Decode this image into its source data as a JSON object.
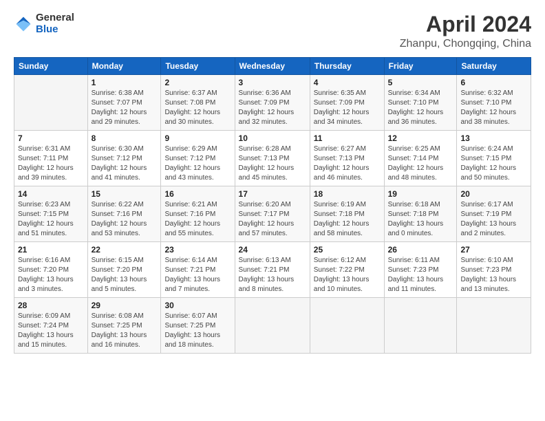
{
  "logo": {
    "general": "General",
    "blue": "Blue"
  },
  "title": "April 2024",
  "subtitle": "Zhanpu, Chongqing, China",
  "days_of_week": [
    "Sunday",
    "Monday",
    "Tuesday",
    "Wednesday",
    "Thursday",
    "Friday",
    "Saturday"
  ],
  "weeks": [
    [
      {
        "day": "",
        "info": ""
      },
      {
        "day": "1",
        "info": "Sunrise: 6:38 AM\nSunset: 7:07 PM\nDaylight: 12 hours\nand 29 minutes."
      },
      {
        "day": "2",
        "info": "Sunrise: 6:37 AM\nSunset: 7:08 PM\nDaylight: 12 hours\nand 30 minutes."
      },
      {
        "day": "3",
        "info": "Sunrise: 6:36 AM\nSunset: 7:09 PM\nDaylight: 12 hours\nand 32 minutes."
      },
      {
        "day": "4",
        "info": "Sunrise: 6:35 AM\nSunset: 7:09 PM\nDaylight: 12 hours\nand 34 minutes."
      },
      {
        "day": "5",
        "info": "Sunrise: 6:34 AM\nSunset: 7:10 PM\nDaylight: 12 hours\nand 36 minutes."
      },
      {
        "day": "6",
        "info": "Sunrise: 6:32 AM\nSunset: 7:10 PM\nDaylight: 12 hours\nand 38 minutes."
      }
    ],
    [
      {
        "day": "7",
        "info": "Sunrise: 6:31 AM\nSunset: 7:11 PM\nDaylight: 12 hours\nand 39 minutes."
      },
      {
        "day": "8",
        "info": "Sunrise: 6:30 AM\nSunset: 7:12 PM\nDaylight: 12 hours\nand 41 minutes."
      },
      {
        "day": "9",
        "info": "Sunrise: 6:29 AM\nSunset: 7:12 PM\nDaylight: 12 hours\nand 43 minutes."
      },
      {
        "day": "10",
        "info": "Sunrise: 6:28 AM\nSunset: 7:13 PM\nDaylight: 12 hours\nand 45 minutes."
      },
      {
        "day": "11",
        "info": "Sunrise: 6:27 AM\nSunset: 7:13 PM\nDaylight: 12 hours\nand 46 minutes."
      },
      {
        "day": "12",
        "info": "Sunrise: 6:25 AM\nSunset: 7:14 PM\nDaylight: 12 hours\nand 48 minutes."
      },
      {
        "day": "13",
        "info": "Sunrise: 6:24 AM\nSunset: 7:15 PM\nDaylight: 12 hours\nand 50 minutes."
      }
    ],
    [
      {
        "day": "14",
        "info": "Sunrise: 6:23 AM\nSunset: 7:15 PM\nDaylight: 12 hours\nand 51 minutes."
      },
      {
        "day": "15",
        "info": "Sunrise: 6:22 AM\nSunset: 7:16 PM\nDaylight: 12 hours\nand 53 minutes."
      },
      {
        "day": "16",
        "info": "Sunrise: 6:21 AM\nSunset: 7:16 PM\nDaylight: 12 hours\nand 55 minutes."
      },
      {
        "day": "17",
        "info": "Sunrise: 6:20 AM\nSunset: 7:17 PM\nDaylight: 12 hours\nand 57 minutes."
      },
      {
        "day": "18",
        "info": "Sunrise: 6:19 AM\nSunset: 7:18 PM\nDaylight: 12 hours\nand 58 minutes."
      },
      {
        "day": "19",
        "info": "Sunrise: 6:18 AM\nSunset: 7:18 PM\nDaylight: 13 hours\nand 0 minutes."
      },
      {
        "day": "20",
        "info": "Sunrise: 6:17 AM\nSunset: 7:19 PM\nDaylight: 13 hours\nand 2 minutes."
      }
    ],
    [
      {
        "day": "21",
        "info": "Sunrise: 6:16 AM\nSunset: 7:20 PM\nDaylight: 13 hours\nand 3 minutes."
      },
      {
        "day": "22",
        "info": "Sunrise: 6:15 AM\nSunset: 7:20 PM\nDaylight: 13 hours\nand 5 minutes."
      },
      {
        "day": "23",
        "info": "Sunrise: 6:14 AM\nSunset: 7:21 PM\nDaylight: 13 hours\nand 7 minutes."
      },
      {
        "day": "24",
        "info": "Sunrise: 6:13 AM\nSunset: 7:21 PM\nDaylight: 13 hours\nand 8 minutes."
      },
      {
        "day": "25",
        "info": "Sunrise: 6:12 AM\nSunset: 7:22 PM\nDaylight: 13 hours\nand 10 minutes."
      },
      {
        "day": "26",
        "info": "Sunrise: 6:11 AM\nSunset: 7:23 PM\nDaylight: 13 hours\nand 11 minutes."
      },
      {
        "day": "27",
        "info": "Sunrise: 6:10 AM\nSunset: 7:23 PM\nDaylight: 13 hours\nand 13 minutes."
      }
    ],
    [
      {
        "day": "28",
        "info": "Sunrise: 6:09 AM\nSunset: 7:24 PM\nDaylight: 13 hours\nand 15 minutes."
      },
      {
        "day": "29",
        "info": "Sunrise: 6:08 AM\nSunset: 7:25 PM\nDaylight: 13 hours\nand 16 minutes."
      },
      {
        "day": "30",
        "info": "Sunrise: 6:07 AM\nSunset: 7:25 PM\nDaylight: 13 hours\nand 18 minutes."
      },
      {
        "day": "",
        "info": ""
      },
      {
        "day": "",
        "info": ""
      },
      {
        "day": "",
        "info": ""
      },
      {
        "day": "",
        "info": ""
      }
    ]
  ]
}
